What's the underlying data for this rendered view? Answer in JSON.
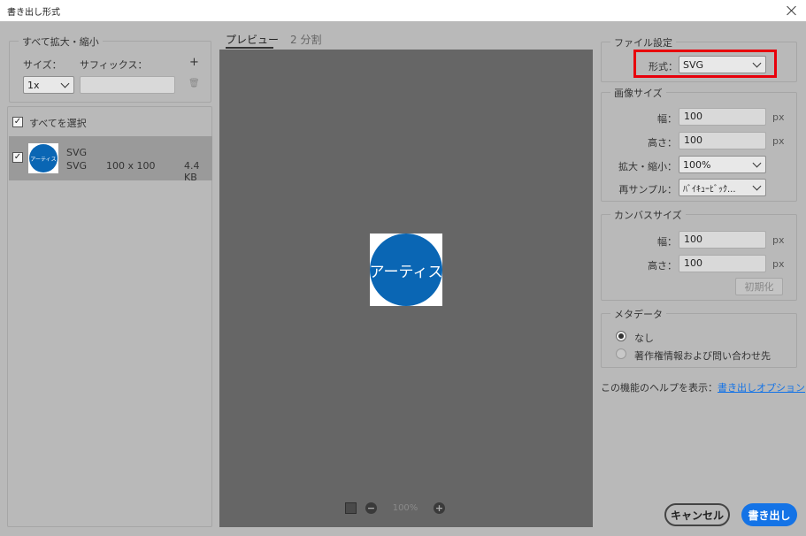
{
  "window": {
    "title": "書き出し形式"
  },
  "scale_all": {
    "legend": "すべて拡大・縮小",
    "size_label": "サイズ：",
    "suffix_label": "サフィックス：",
    "add_label": "+",
    "size_value": "1x",
    "suffix_value": ""
  },
  "assets": {
    "select_all_label": "すべてを選択",
    "items": [
      {
        "thumb_text": "アーティス",
        "name": "SVG",
        "format": "SVG",
        "dimensions": "100 x 100",
        "size": "4.4 KB",
        "checked": true
      }
    ]
  },
  "tabs": {
    "preview": "プレビュー",
    "split": "2 分割"
  },
  "preview": {
    "image_text": "アーティス",
    "zoom": "100%",
    "zoom_out_icon": "−",
    "zoom_in_icon": "+"
  },
  "file_settings": {
    "legend": "ファイル設定",
    "format_label": "形式：",
    "format_value": "SVG"
  },
  "image_size": {
    "legend": "画像サイズ",
    "width_label": "幅：",
    "width_value": "100",
    "width_unit": "px",
    "height_label": "高さ：",
    "height_value": "100",
    "height_unit": "px",
    "scale_label": "拡大・縮小：",
    "scale_value": "100%",
    "resample_label": "再サンプル：",
    "resample_value": "ﾊﾞｲｷｭｰﾋﾞｯｸ..."
  },
  "canvas_size": {
    "legend": "カンバスサイズ",
    "width_label": "幅：",
    "width_value": "100",
    "width_unit": "px",
    "height_label": "高さ：",
    "height_value": "100",
    "height_unit": "px",
    "reset_label": "初期化"
  },
  "metadata": {
    "legend": "メタデータ",
    "none_label": "なし",
    "copyright_label": "著作権情報および問い合わせ先"
  },
  "help": {
    "text": "この機能のヘルプを表示：",
    "link": "書き出しオプション"
  },
  "buttons": {
    "cancel": "キャンセル",
    "export": "書き出し"
  },
  "colors": {
    "accent": "#1473e6",
    "highlight": "#e8000b",
    "circle": "#0a66b4"
  }
}
